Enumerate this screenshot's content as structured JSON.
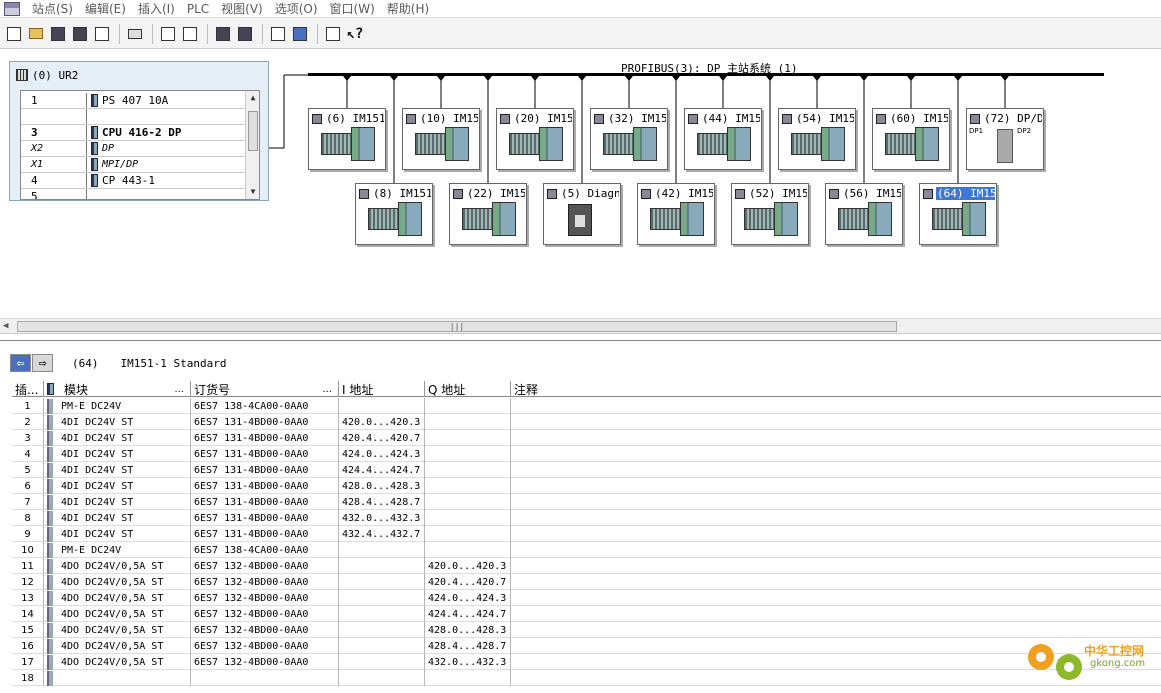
{
  "menu": {
    "items": [
      "站点(S)",
      "编辑(E)",
      "插入(I)",
      "PLC",
      "视图(V)",
      "选项(O)",
      "窗口(W)",
      "帮助(H)"
    ]
  },
  "toolbar": {
    "icons": [
      "new-icon",
      "open-icon",
      "network-icon",
      "save-icon",
      "compile-icon",
      "print-icon",
      "copy-icon",
      "paste-icon",
      "download-icon",
      "upload-icon",
      "catalog-icon",
      "view-icon",
      "network-view-icon",
      "help-icon"
    ]
  },
  "rack": {
    "title": "(0) UR2",
    "rows": [
      {
        "slot": "1",
        "module": "PS 407 10A",
        "style": "normal"
      },
      {
        "slot": "",
        "module": "",
        "style": "normal"
      },
      {
        "slot": "3",
        "module": "CPU 416-2 DP",
        "style": "bold"
      },
      {
        "slot": "X2",
        "module": "DP",
        "style": "ital"
      },
      {
        "slot": "X1",
        "module": "MPI/DP",
        "style": "ital"
      },
      {
        "slot": "4",
        "module": "CP 443-1",
        "style": "normal"
      },
      {
        "slot": "5",
        "module": "",
        "style": "normal"
      }
    ]
  },
  "bus": {
    "label": "PROFIBUS(3): DP 主站系统 (1)"
  },
  "stations_top": [
    {
      "label": "(6) IM151",
      "type": "im"
    },
    {
      "label": "(10) IM15",
      "type": "im"
    },
    {
      "label": "(20) IM15",
      "type": "im"
    },
    {
      "label": "(32) IM15",
      "type": "im"
    },
    {
      "label": "(44) IM15",
      "type": "im"
    },
    {
      "label": "(54) IM15",
      "type": "im"
    },
    {
      "label": "(60) IM15",
      "type": "im"
    },
    {
      "label": "(72) DP/D",
      "type": "dpdp",
      "dp1": "DP1",
      "dp2": "DP2"
    }
  ],
  "stations_bottom": [
    {
      "label": "(8) IM151",
      "type": "im"
    },
    {
      "label": "(22) IM15",
      "type": "im"
    },
    {
      "label": "(5) Diagn",
      "type": "diag"
    },
    {
      "label": "(42) IM15",
      "type": "im"
    },
    {
      "label": "(52) IM15",
      "type": "im"
    },
    {
      "label": "(56) IM15",
      "type": "im"
    },
    {
      "label": "(64) IM15",
      "type": "im",
      "selected": true
    }
  ],
  "detail": {
    "station_id": "(64)",
    "station_desc": "IM151-1 Standard",
    "headers": {
      "slot": "插...",
      "module": "模块",
      "module_dots": "...",
      "order": "订货号",
      "order_dots": "...",
      "i_addr": "I 地址",
      "q_addr": "Q 地址",
      "comment": "注释"
    },
    "rows": [
      {
        "slot": "1",
        "module": "PM-E DC24V",
        "order": "6ES7 138-4CA00-0AA0",
        "i": "",
        "q": ""
      },
      {
        "slot": "2",
        "module": "4DI DC24V ST",
        "order": "6ES7 131-4BD00-0AA0",
        "i": "420.0...420.3",
        "q": ""
      },
      {
        "slot": "3",
        "module": "4DI DC24V ST",
        "order": "6ES7 131-4BD00-0AA0",
        "i": "420.4...420.7",
        "q": ""
      },
      {
        "slot": "4",
        "module": "4DI DC24V ST",
        "order": "6ES7 131-4BD00-0AA0",
        "i": "424.0...424.3",
        "q": ""
      },
      {
        "slot": "5",
        "module": "4DI DC24V ST",
        "order": "6ES7 131-4BD00-0AA0",
        "i": "424.4...424.7",
        "q": ""
      },
      {
        "slot": "6",
        "module": "4DI DC24V ST",
        "order": "6ES7 131-4BD00-0AA0",
        "i": "428.0...428.3",
        "q": ""
      },
      {
        "slot": "7",
        "module": "4DI DC24V ST",
        "order": "6ES7 131-4BD00-0AA0",
        "i": "428.4...428.7",
        "q": ""
      },
      {
        "slot": "8",
        "module": "4DI DC24V ST",
        "order": "6ES7 131-4BD00-0AA0",
        "i": "432.0...432.3",
        "q": ""
      },
      {
        "slot": "9",
        "module": "4DI DC24V ST",
        "order": "6ES7 131-4BD00-0AA0",
        "i": "432.4...432.7",
        "q": ""
      },
      {
        "slot": "10",
        "module": "PM-E DC24V",
        "order": "6ES7 138-4CA00-0AA0",
        "i": "",
        "q": ""
      },
      {
        "slot": "11",
        "module": "4DO DC24V/0,5A ST",
        "order": "6ES7 132-4BD00-0AA0",
        "i": "",
        "q": "420.0...420.3"
      },
      {
        "slot": "12",
        "module": "4DO DC24V/0,5A ST",
        "order": "6ES7 132-4BD00-0AA0",
        "i": "",
        "q": "420.4...420.7"
      },
      {
        "slot": "13",
        "module": "4DO DC24V/0,5A ST",
        "order": "6ES7 132-4BD00-0AA0",
        "i": "",
        "q": "424.0...424.3"
      },
      {
        "slot": "14",
        "module": "4DO DC24V/0,5A ST",
        "order": "6ES7 132-4BD00-0AA0",
        "i": "",
        "q": "424.4...424.7"
      },
      {
        "slot": "15",
        "module": "4DO DC24V/0,5A ST",
        "order": "6ES7 132-4BD00-0AA0",
        "i": "",
        "q": "428.0...428.3"
      },
      {
        "slot": "16",
        "module": "4DO DC24V/0,5A ST",
        "order": "6ES7 132-4BD00-0AA0",
        "i": "",
        "q": "428.4...428.7"
      },
      {
        "slot": "17",
        "module": "4DO DC24V/0,5A ST",
        "order": "6ES7 132-4BD00-0AA0",
        "i": "",
        "q": "432.0...432.3"
      },
      {
        "slot": "18",
        "module": "",
        "order": "",
        "i": "",
        "q": ""
      }
    ]
  },
  "watermark": {
    "text": "中华工控网",
    "sub": "gkong.com"
  },
  "colors": {
    "selection": "#3b78d8",
    "watermark_orange": "#f0a020",
    "watermark_green": "#7aa022"
  }
}
